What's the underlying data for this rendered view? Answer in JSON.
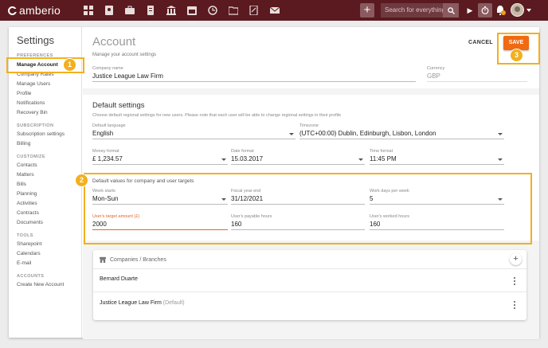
{
  "brand": {
    "name": "amberio"
  },
  "topbar": {
    "nav_icons": [
      "dashboard-icon",
      "contacts-icon",
      "matters-icon",
      "bills-icon",
      "bank-icon",
      "calendar-icon",
      "activities-icon",
      "folder-icon",
      "documents-icon",
      "mail-icon"
    ],
    "add_label": "+",
    "search_placeholder": "Search for everything..."
  },
  "sidebar": {
    "title": "Settings",
    "sections": [
      {
        "label": "PREFERENCES",
        "items": [
          "Manage Account",
          "Company Rates",
          "Manage Users",
          "Profile",
          "Notifications",
          "Recovery Bin"
        ]
      },
      {
        "label": "SUBSCRIPTION",
        "items": [
          "Subscription settings",
          "Billing"
        ]
      },
      {
        "label": "CUSTOMIZE",
        "items": [
          "Contacts",
          "Matters",
          "Bills",
          "Planning",
          "Activities",
          "Contracts",
          "Documents"
        ]
      },
      {
        "label": "TOOLS",
        "items": [
          "Sharepoint",
          "Calendars",
          "E-mail"
        ]
      },
      {
        "label": "ACCOUNTS",
        "items": [
          "Create New Account"
        ]
      }
    ],
    "active_item": "Manage Account"
  },
  "account": {
    "title": "Account",
    "subtitle": "Manage your account settings",
    "cancel_label": "CANCEL",
    "save_label": "SAVE",
    "company_name": {
      "label": "Company name",
      "value": "Justice League Law Firm"
    },
    "currency": {
      "label": "Currency",
      "value": "GBP"
    }
  },
  "defaults": {
    "title": "Default settings",
    "note": "Choose default regional settings for new users. Please note that each user will be able to change regional settings in their profile",
    "language": {
      "label": "Default language",
      "value": "English"
    },
    "timezone": {
      "label": "Timezone",
      "value": "(UTC+00:00) Dublin, Edinburgh, Lisbon, London"
    },
    "money_format": {
      "label": "Money format",
      "value": "£ 1,234.57"
    },
    "date_format": {
      "label": "Date format",
      "value": "15.03.2017"
    },
    "time_format": {
      "label": "Time format",
      "value": "11:45 PM"
    }
  },
  "targets": {
    "title": "Default values for company and user targets",
    "week_starts": {
      "label": "Week starts",
      "value": "Mon-Sun"
    },
    "fiscal_year_end": {
      "label": "Fiscal year end",
      "value": "31/12/2021"
    },
    "work_days": {
      "label": "Work days per week",
      "value": "5"
    },
    "target_amount": {
      "label": "User's target amount (£)",
      "value": "2000"
    },
    "payable_hours": {
      "label": "User's payable hours",
      "value": "160"
    },
    "worked_hours": {
      "label": "User's worked hours",
      "value": "160"
    }
  },
  "branches": {
    "title": "Companies / Branches",
    "add_label": "+",
    "rows": [
      {
        "name": "Bernard Duarte",
        "tag": ""
      },
      {
        "name": "Justice League Law Firm",
        "tag": "(Default)"
      }
    ]
  },
  "callouts": [
    "1",
    "2",
    "3"
  ],
  "colors": {
    "topbar": "#5a1a1f",
    "accent": "#f06a12",
    "highlight": "#f2b01e"
  }
}
